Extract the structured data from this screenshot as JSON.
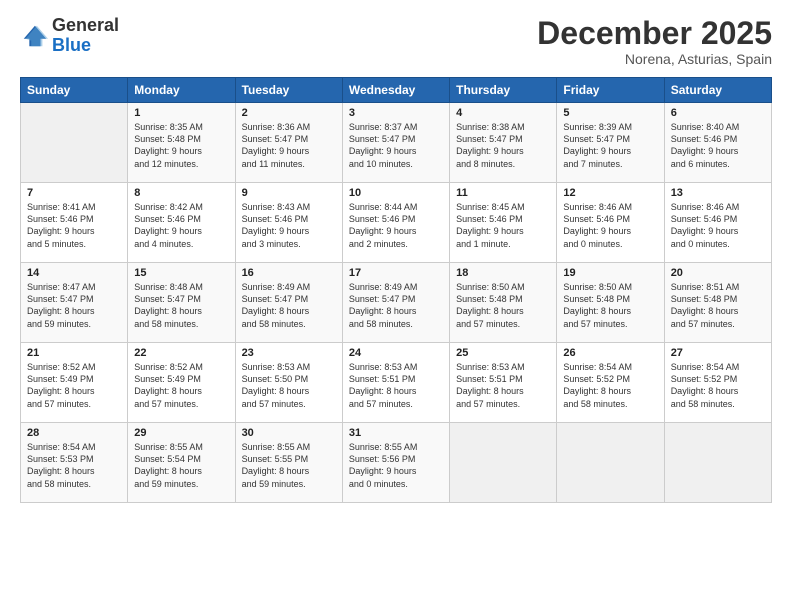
{
  "header": {
    "logo": {
      "general": "General",
      "blue": "Blue"
    },
    "title": "December 2025",
    "location": "Norena, Asturias, Spain"
  },
  "weekdays": [
    "Sunday",
    "Monday",
    "Tuesday",
    "Wednesday",
    "Thursday",
    "Friday",
    "Saturday"
  ],
  "weeks": [
    [
      {
        "day": "",
        "info": ""
      },
      {
        "day": "1",
        "info": "Sunrise: 8:35 AM\nSunset: 5:48 PM\nDaylight: 9 hours\nand 12 minutes."
      },
      {
        "day": "2",
        "info": "Sunrise: 8:36 AM\nSunset: 5:47 PM\nDaylight: 9 hours\nand 11 minutes."
      },
      {
        "day": "3",
        "info": "Sunrise: 8:37 AM\nSunset: 5:47 PM\nDaylight: 9 hours\nand 10 minutes."
      },
      {
        "day": "4",
        "info": "Sunrise: 8:38 AM\nSunset: 5:47 PM\nDaylight: 9 hours\nand 8 minutes."
      },
      {
        "day": "5",
        "info": "Sunrise: 8:39 AM\nSunset: 5:47 PM\nDaylight: 9 hours\nand 7 minutes."
      },
      {
        "day": "6",
        "info": "Sunrise: 8:40 AM\nSunset: 5:46 PM\nDaylight: 9 hours\nand 6 minutes."
      }
    ],
    [
      {
        "day": "7",
        "info": "Sunrise: 8:41 AM\nSunset: 5:46 PM\nDaylight: 9 hours\nand 5 minutes."
      },
      {
        "day": "8",
        "info": "Sunrise: 8:42 AM\nSunset: 5:46 PM\nDaylight: 9 hours\nand 4 minutes."
      },
      {
        "day": "9",
        "info": "Sunrise: 8:43 AM\nSunset: 5:46 PM\nDaylight: 9 hours\nand 3 minutes."
      },
      {
        "day": "10",
        "info": "Sunrise: 8:44 AM\nSunset: 5:46 PM\nDaylight: 9 hours\nand 2 minutes."
      },
      {
        "day": "11",
        "info": "Sunrise: 8:45 AM\nSunset: 5:46 PM\nDaylight: 9 hours\nand 1 minute."
      },
      {
        "day": "12",
        "info": "Sunrise: 8:46 AM\nSunset: 5:46 PM\nDaylight: 9 hours\nand 0 minutes."
      },
      {
        "day": "13",
        "info": "Sunrise: 8:46 AM\nSunset: 5:46 PM\nDaylight: 9 hours\nand 0 minutes."
      }
    ],
    [
      {
        "day": "14",
        "info": "Sunrise: 8:47 AM\nSunset: 5:47 PM\nDaylight: 8 hours\nand 59 minutes."
      },
      {
        "day": "15",
        "info": "Sunrise: 8:48 AM\nSunset: 5:47 PM\nDaylight: 8 hours\nand 58 minutes."
      },
      {
        "day": "16",
        "info": "Sunrise: 8:49 AM\nSunset: 5:47 PM\nDaylight: 8 hours\nand 58 minutes."
      },
      {
        "day": "17",
        "info": "Sunrise: 8:49 AM\nSunset: 5:47 PM\nDaylight: 8 hours\nand 58 minutes."
      },
      {
        "day": "18",
        "info": "Sunrise: 8:50 AM\nSunset: 5:48 PM\nDaylight: 8 hours\nand 57 minutes."
      },
      {
        "day": "19",
        "info": "Sunrise: 8:50 AM\nSunset: 5:48 PM\nDaylight: 8 hours\nand 57 minutes."
      },
      {
        "day": "20",
        "info": "Sunrise: 8:51 AM\nSunset: 5:48 PM\nDaylight: 8 hours\nand 57 minutes."
      }
    ],
    [
      {
        "day": "21",
        "info": "Sunrise: 8:52 AM\nSunset: 5:49 PM\nDaylight: 8 hours\nand 57 minutes."
      },
      {
        "day": "22",
        "info": "Sunrise: 8:52 AM\nSunset: 5:49 PM\nDaylight: 8 hours\nand 57 minutes."
      },
      {
        "day": "23",
        "info": "Sunrise: 8:53 AM\nSunset: 5:50 PM\nDaylight: 8 hours\nand 57 minutes."
      },
      {
        "day": "24",
        "info": "Sunrise: 8:53 AM\nSunset: 5:51 PM\nDaylight: 8 hours\nand 57 minutes."
      },
      {
        "day": "25",
        "info": "Sunrise: 8:53 AM\nSunset: 5:51 PM\nDaylight: 8 hours\nand 57 minutes."
      },
      {
        "day": "26",
        "info": "Sunrise: 8:54 AM\nSunset: 5:52 PM\nDaylight: 8 hours\nand 58 minutes."
      },
      {
        "day": "27",
        "info": "Sunrise: 8:54 AM\nSunset: 5:52 PM\nDaylight: 8 hours\nand 58 minutes."
      }
    ],
    [
      {
        "day": "28",
        "info": "Sunrise: 8:54 AM\nSunset: 5:53 PM\nDaylight: 8 hours\nand 58 minutes."
      },
      {
        "day": "29",
        "info": "Sunrise: 8:55 AM\nSunset: 5:54 PM\nDaylight: 8 hours\nand 59 minutes."
      },
      {
        "day": "30",
        "info": "Sunrise: 8:55 AM\nSunset: 5:55 PM\nDaylight: 8 hours\nand 59 minutes."
      },
      {
        "day": "31",
        "info": "Sunrise: 8:55 AM\nSunset: 5:56 PM\nDaylight: 9 hours\nand 0 minutes."
      },
      {
        "day": "",
        "info": ""
      },
      {
        "day": "",
        "info": ""
      },
      {
        "day": "",
        "info": ""
      }
    ]
  ]
}
